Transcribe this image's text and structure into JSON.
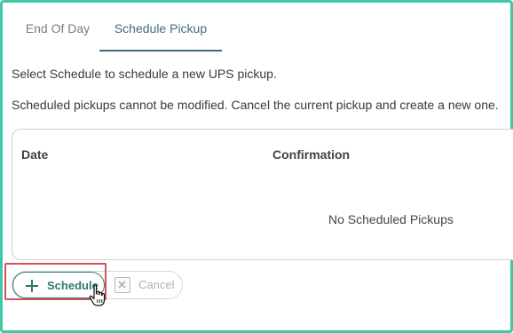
{
  "tabs": [
    {
      "label": "End Of Day",
      "active": false
    },
    {
      "label": "Schedule Pickup",
      "active": true
    }
  ],
  "info": {
    "line1": "Select Schedule to schedule a new UPS pickup.",
    "line2": "Scheduled pickups cannot be modified. Cancel the current pickup and create a new one."
  },
  "table": {
    "headers": [
      "Date",
      "Confirmation"
    ],
    "empty_message": "No Scheduled Pickups"
  },
  "actions": {
    "schedule_label": "Schedule",
    "cancel_label": "Cancel",
    "schedule_icon": "plus-icon",
    "cancel_icon": "close-box-icon"
  },
  "colors": {
    "frame": "#3fc7a8",
    "accent": "#2d7a6c",
    "active_tab": "#3f6e78",
    "highlight": "#d64f5a"
  }
}
